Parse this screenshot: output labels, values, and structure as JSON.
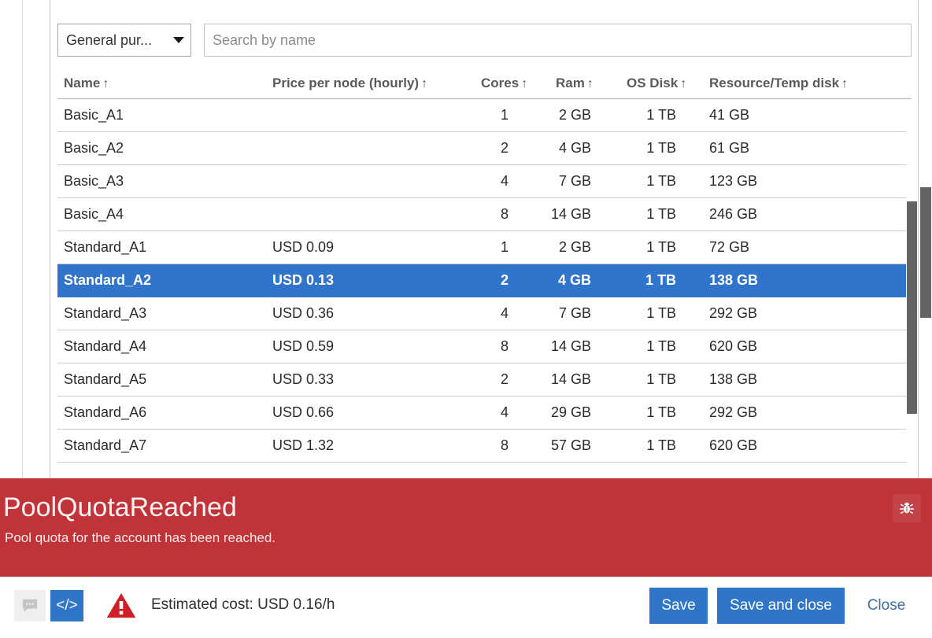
{
  "filter": {
    "sku_select_value": "General pur...",
    "sku_caret_icon": "chevron-down-icon",
    "search_placeholder": "Search by name",
    "search_value": ""
  },
  "table": {
    "sort_arrow": "↑",
    "columns": [
      {
        "key": "name",
        "label": "Name"
      },
      {
        "key": "price",
        "label": "Price per node (hourly)"
      },
      {
        "key": "cores",
        "label": "Cores"
      },
      {
        "key": "ram",
        "label": "Ram"
      },
      {
        "key": "osdisk",
        "label": "OS Disk"
      },
      {
        "key": "resdisk",
        "label": "Resource/Temp disk"
      }
    ],
    "rows": [
      {
        "name": "Basic_A1",
        "price": "",
        "cores": "1",
        "ram": "2 GB",
        "osdisk": "1 TB",
        "resdisk": "41 GB",
        "selected": false
      },
      {
        "name": "Basic_A2",
        "price": "",
        "cores": "2",
        "ram": "4 GB",
        "osdisk": "1 TB",
        "resdisk": "61 GB",
        "selected": false
      },
      {
        "name": "Basic_A3",
        "price": "",
        "cores": "4",
        "ram": "7 GB",
        "osdisk": "1 TB",
        "resdisk": "123 GB",
        "selected": false
      },
      {
        "name": "Basic_A4",
        "price": "",
        "cores": "8",
        "ram": "14 GB",
        "osdisk": "1 TB",
        "resdisk": "246 GB",
        "selected": false
      },
      {
        "name": "Standard_A1",
        "price": "USD 0.09",
        "cores": "1",
        "ram": "2 GB",
        "osdisk": "1 TB",
        "resdisk": "72 GB",
        "selected": false
      },
      {
        "name": "Standard_A2",
        "price": "USD 0.13",
        "cores": "2",
        "ram": "4 GB",
        "osdisk": "1 TB",
        "resdisk": "138 GB",
        "selected": true
      },
      {
        "name": "Standard_A3",
        "price": "USD 0.36",
        "cores": "4",
        "ram": "7 GB",
        "osdisk": "1 TB",
        "resdisk": "292 GB",
        "selected": false
      },
      {
        "name": "Standard_A4",
        "price": "USD 0.59",
        "cores": "8",
        "ram": "14 GB",
        "osdisk": "1 TB",
        "resdisk": "620 GB",
        "selected": false
      },
      {
        "name": "Standard_A5",
        "price": "USD 0.33",
        "cores": "2",
        "ram": "14 GB",
        "osdisk": "1 TB",
        "resdisk": "138 GB",
        "selected": false
      },
      {
        "name": "Standard_A6",
        "price": "USD 0.66",
        "cores": "4",
        "ram": "29 GB",
        "osdisk": "1 TB",
        "resdisk": "292 GB",
        "selected": false
      },
      {
        "name": "Standard_A7",
        "price": "USD 1.32",
        "cores": "8",
        "ram": "57 GB",
        "osdisk": "1 TB",
        "resdisk": "620 GB",
        "selected": false
      },
      {
        "name": "",
        "price": "",
        "cores": "",
        "ram": "",
        "osdisk": "",
        "resdisk": "",
        "selected": false
      }
    ]
  },
  "error": {
    "title": "PoolQuotaReached",
    "message": "Pool quota for the account has been reached.",
    "bug_icon": "bug-icon",
    "background_color": "#bf3339"
  },
  "actions": {
    "chat_icon": "chat-bubble-icon",
    "code_icon": "code-brackets-icon",
    "code_label": "</>",
    "warning_icon": "warning-triangle-icon",
    "cost_text": "Estimated cost: USD 0.16/h",
    "save_label": "Save",
    "save_and_close_label": "Save and close",
    "close_label": "Close",
    "accent_color": "#2f76c8"
  }
}
